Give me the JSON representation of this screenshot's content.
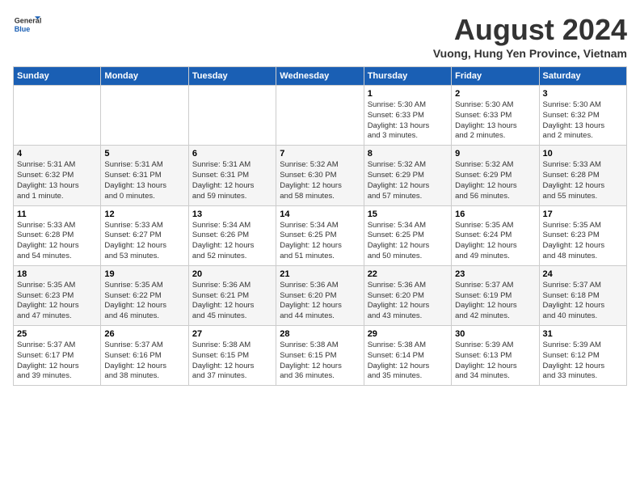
{
  "logo": {
    "line1": "General",
    "line2": "Blue"
  },
  "title": "August 2024",
  "subtitle": "Vuong, Hung Yen Province, Vietnam",
  "weekdays": [
    "Sunday",
    "Monday",
    "Tuesday",
    "Wednesday",
    "Thursday",
    "Friday",
    "Saturday"
  ],
  "weeks": [
    [
      {
        "day": "",
        "info": ""
      },
      {
        "day": "",
        "info": ""
      },
      {
        "day": "",
        "info": ""
      },
      {
        "day": "",
        "info": ""
      },
      {
        "day": "1",
        "info": "Sunrise: 5:30 AM\nSunset: 6:33 PM\nDaylight: 13 hours\nand 3 minutes."
      },
      {
        "day": "2",
        "info": "Sunrise: 5:30 AM\nSunset: 6:33 PM\nDaylight: 13 hours\nand 2 minutes."
      },
      {
        "day": "3",
        "info": "Sunrise: 5:30 AM\nSunset: 6:32 PM\nDaylight: 13 hours\nand 2 minutes."
      }
    ],
    [
      {
        "day": "4",
        "info": "Sunrise: 5:31 AM\nSunset: 6:32 PM\nDaylight: 13 hours\nand 1 minute."
      },
      {
        "day": "5",
        "info": "Sunrise: 5:31 AM\nSunset: 6:31 PM\nDaylight: 13 hours\nand 0 minutes."
      },
      {
        "day": "6",
        "info": "Sunrise: 5:31 AM\nSunset: 6:31 PM\nDaylight: 12 hours\nand 59 minutes."
      },
      {
        "day": "7",
        "info": "Sunrise: 5:32 AM\nSunset: 6:30 PM\nDaylight: 12 hours\nand 58 minutes."
      },
      {
        "day": "8",
        "info": "Sunrise: 5:32 AM\nSunset: 6:29 PM\nDaylight: 12 hours\nand 57 minutes."
      },
      {
        "day": "9",
        "info": "Sunrise: 5:32 AM\nSunset: 6:29 PM\nDaylight: 12 hours\nand 56 minutes."
      },
      {
        "day": "10",
        "info": "Sunrise: 5:33 AM\nSunset: 6:28 PM\nDaylight: 12 hours\nand 55 minutes."
      }
    ],
    [
      {
        "day": "11",
        "info": "Sunrise: 5:33 AM\nSunset: 6:28 PM\nDaylight: 12 hours\nand 54 minutes."
      },
      {
        "day": "12",
        "info": "Sunrise: 5:33 AM\nSunset: 6:27 PM\nDaylight: 12 hours\nand 53 minutes."
      },
      {
        "day": "13",
        "info": "Sunrise: 5:34 AM\nSunset: 6:26 PM\nDaylight: 12 hours\nand 52 minutes."
      },
      {
        "day": "14",
        "info": "Sunrise: 5:34 AM\nSunset: 6:25 PM\nDaylight: 12 hours\nand 51 minutes."
      },
      {
        "day": "15",
        "info": "Sunrise: 5:34 AM\nSunset: 6:25 PM\nDaylight: 12 hours\nand 50 minutes."
      },
      {
        "day": "16",
        "info": "Sunrise: 5:35 AM\nSunset: 6:24 PM\nDaylight: 12 hours\nand 49 minutes."
      },
      {
        "day": "17",
        "info": "Sunrise: 5:35 AM\nSunset: 6:23 PM\nDaylight: 12 hours\nand 48 minutes."
      }
    ],
    [
      {
        "day": "18",
        "info": "Sunrise: 5:35 AM\nSunset: 6:23 PM\nDaylight: 12 hours\nand 47 minutes."
      },
      {
        "day": "19",
        "info": "Sunrise: 5:35 AM\nSunset: 6:22 PM\nDaylight: 12 hours\nand 46 minutes."
      },
      {
        "day": "20",
        "info": "Sunrise: 5:36 AM\nSunset: 6:21 PM\nDaylight: 12 hours\nand 45 minutes."
      },
      {
        "day": "21",
        "info": "Sunrise: 5:36 AM\nSunset: 6:20 PM\nDaylight: 12 hours\nand 44 minutes."
      },
      {
        "day": "22",
        "info": "Sunrise: 5:36 AM\nSunset: 6:20 PM\nDaylight: 12 hours\nand 43 minutes."
      },
      {
        "day": "23",
        "info": "Sunrise: 5:37 AM\nSunset: 6:19 PM\nDaylight: 12 hours\nand 42 minutes."
      },
      {
        "day": "24",
        "info": "Sunrise: 5:37 AM\nSunset: 6:18 PM\nDaylight: 12 hours\nand 40 minutes."
      }
    ],
    [
      {
        "day": "25",
        "info": "Sunrise: 5:37 AM\nSunset: 6:17 PM\nDaylight: 12 hours\nand 39 minutes."
      },
      {
        "day": "26",
        "info": "Sunrise: 5:37 AM\nSunset: 6:16 PM\nDaylight: 12 hours\nand 38 minutes."
      },
      {
        "day": "27",
        "info": "Sunrise: 5:38 AM\nSunset: 6:15 PM\nDaylight: 12 hours\nand 37 minutes."
      },
      {
        "day": "28",
        "info": "Sunrise: 5:38 AM\nSunset: 6:15 PM\nDaylight: 12 hours\nand 36 minutes."
      },
      {
        "day": "29",
        "info": "Sunrise: 5:38 AM\nSunset: 6:14 PM\nDaylight: 12 hours\nand 35 minutes."
      },
      {
        "day": "30",
        "info": "Sunrise: 5:39 AM\nSunset: 6:13 PM\nDaylight: 12 hours\nand 34 minutes."
      },
      {
        "day": "31",
        "info": "Sunrise: 5:39 AM\nSunset: 6:12 PM\nDaylight: 12 hours\nand 33 minutes."
      }
    ]
  ]
}
